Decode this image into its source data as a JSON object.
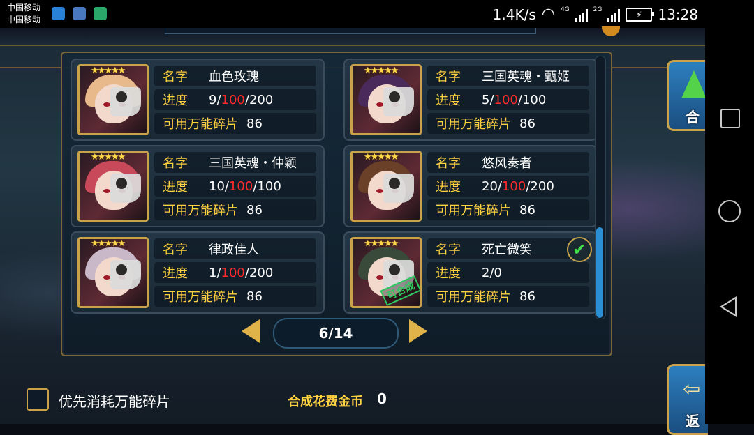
{
  "status_bar": {
    "carrier_1": "中国移动",
    "carrier_2": "中国移动",
    "speed": "1.4K/s",
    "net_4g": "4G",
    "net_2g": "2G",
    "time": "13:28"
  },
  "pieces": [
    {
      "stars": "★★★★★",
      "name_label": "名字",
      "name": "血色玫瑰",
      "progress_label": "进度",
      "progress_current": "9",
      "progress_mid": "100",
      "progress_max": "200",
      "sep1": "/",
      "sep2": "/",
      "available_label": "可用万能碎片",
      "available": "86",
      "hair": "#e8b98a"
    },
    {
      "stars": "★★★★★",
      "name_label": "名字",
      "name": "三国英魂・甄姬",
      "progress_label": "进度",
      "progress_current": "5",
      "progress_mid": "100",
      "progress_max": "100",
      "sep1": "/",
      "sep2": "/",
      "available_label": "可用万能碎片",
      "available": "86",
      "hair": "#4a2a5a"
    },
    {
      "stars": "★★★★★",
      "name_label": "名字",
      "name": "三国英魂・仲颖",
      "progress_label": "进度",
      "progress_current": "10",
      "progress_mid": "100",
      "progress_max": "100",
      "sep1": "/",
      "sep2": "/",
      "available_label": "可用万能碎片",
      "available": "86",
      "hair": "#c84a5a"
    },
    {
      "stars": "★★★★★",
      "name_label": "名字",
      "name": "悠风奏者",
      "progress_label": "进度",
      "progress_current": "20",
      "progress_mid": "100",
      "progress_max": "200",
      "sep1": "/",
      "sep2": "/",
      "available_label": "可用万能碎片",
      "available": "86",
      "hair": "#6a4028"
    },
    {
      "stars": "★★★★★",
      "name_label": "名字",
      "name": "律政佳人",
      "progress_label": "进度",
      "progress_current": "1",
      "progress_mid": "100",
      "progress_max": "200",
      "sep1": "/",
      "sep2": "/",
      "available_label": "可用万能碎片",
      "available": "86",
      "hair": "#c8b8c8"
    },
    {
      "stars": "★★★★★",
      "name_label": "名字",
      "name": "死亡微笑",
      "progress_label": "进度",
      "progress_text": "2/0",
      "available_label": "可用万能碎片",
      "available": "86",
      "hair": "#3a4a3a",
      "badge": "可合成"
    }
  ],
  "pager": {
    "text": "6/14"
  },
  "side": {
    "compose": "合",
    "back": "返"
  },
  "footer": {
    "priority_label": "优先消耗万能碎片",
    "cost_label": "合成花费金币",
    "cost_value": "0"
  },
  "colors": {
    "label_gold": "#ffd040",
    "highlight_red": "#ff2a2a",
    "frame_gold": "#c9a24a"
  }
}
